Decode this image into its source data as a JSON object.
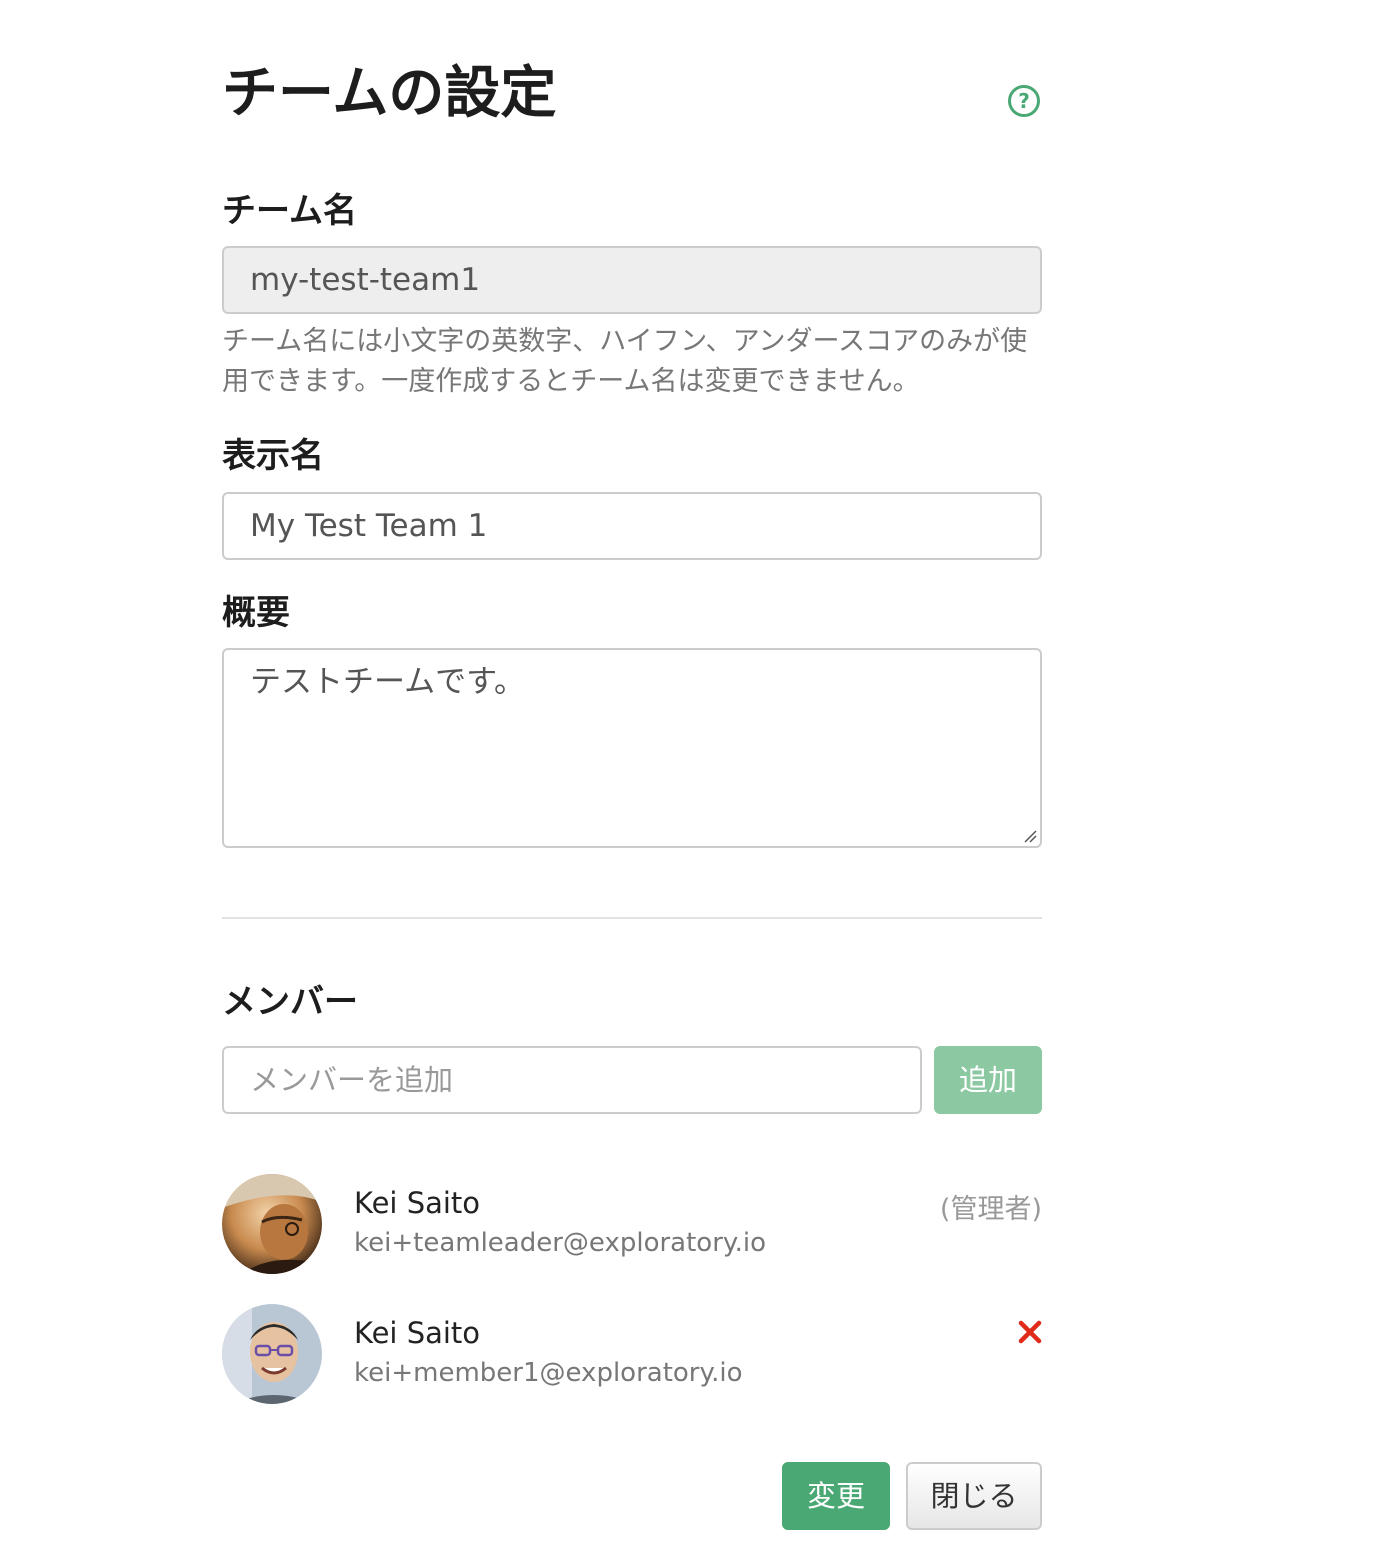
{
  "dialog": {
    "title": "チームの設定",
    "help_icon": "question-circle-icon",
    "accent_color": "#4aa874"
  },
  "team_name": {
    "label": "チーム名",
    "value": "my-test-team1",
    "help_text": "チーム名には小文字の英数字、ハイフン、アンダースコアのみが使用できます。一度作成するとチーム名は変更できません。"
  },
  "display_name": {
    "label": "表示名",
    "value": "My Test Team 1"
  },
  "description": {
    "label": "概要",
    "value": "テストチームです。"
  },
  "members": {
    "label": "メンバー",
    "add_placeholder": "メンバーを追加",
    "add_button": "追加",
    "list": [
      {
        "name": "Kei Saito",
        "email": "kei+teamleader@exploratory.io",
        "role": "(管理者)",
        "removable": false
      },
      {
        "name": "Kei Saito",
        "email": "kei+member1@exploratory.io",
        "role": "",
        "removable": true,
        "remove_icon": "close-x-icon",
        "remove_color": "#e02a1a"
      }
    ]
  },
  "footer": {
    "save_button": "変更",
    "close_button": "閉じる"
  }
}
